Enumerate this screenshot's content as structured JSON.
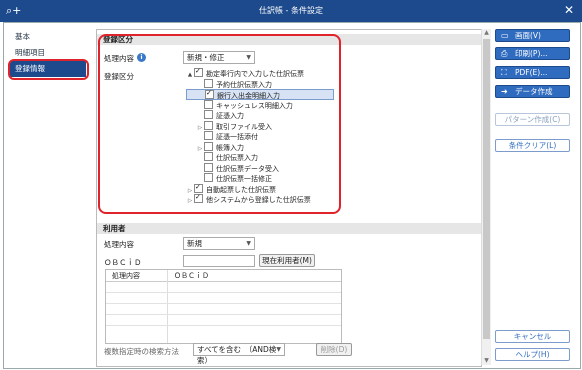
{
  "window": {
    "title": "仕訳帳 - 条件設定",
    "close_icon": "close-icon"
  },
  "sidebar": {
    "items": [
      {
        "label": "基本"
      },
      {
        "label": "明細項目"
      },
      {
        "label": "登録情報",
        "active": true
      }
    ]
  },
  "registration": {
    "section_title": "登録区分",
    "process_label": "処理内容",
    "process_value": "新規・修正",
    "category_label": "登録区分",
    "tree": [
      {
        "label": "勘定奉行内で入力した仕訳伝票",
        "checked": true,
        "expander": "▲",
        "indent": 0
      },
      {
        "label": "予約仕訳伝票入力",
        "checked": false,
        "indent": 1
      },
      {
        "label": "銀行入出金明細入力",
        "checked": true,
        "indent": 1,
        "selected": true
      },
      {
        "label": "キャッシュレス明細入力",
        "checked": false,
        "indent": 1
      },
      {
        "label": "証憑入力",
        "checked": false,
        "indent": 1
      },
      {
        "label": "取引ファイル受入",
        "checked": false,
        "expander": "▷",
        "indent": 1
      },
      {
        "label": "証憑一括添付",
        "checked": false,
        "indent": 1
      },
      {
        "label": "帳簿入力",
        "checked": false,
        "expander": "▷",
        "indent": 1
      },
      {
        "label": "仕訳伝票入力",
        "checked": false,
        "indent": 1
      },
      {
        "label": "仕訳伝票データ受入",
        "checked": false,
        "indent": 1
      },
      {
        "label": "仕訳伝票一括修正",
        "checked": false,
        "indent": 1
      },
      {
        "label": "自動起票した仕訳伝票",
        "checked": true,
        "expander": "▷",
        "indent": 0
      },
      {
        "label": "他システムから登録した仕訳伝票",
        "checked": true,
        "expander": "▷",
        "indent": 0
      }
    ]
  },
  "user": {
    "section_title": "利用者",
    "process_label": "処理内容",
    "process_value": "新規",
    "obcid_label": "ＯＢＣｉＤ",
    "current_user_button": "現在利用者(M)",
    "grid_headers": [
      "処理内容",
      "ＯＢＣｉＤ"
    ],
    "search_label": "複数指定時の検索方法",
    "search_value": "すべてを含む　（AND検索）",
    "delete_button": "削除(D)"
  },
  "right_buttons": [
    {
      "label": "画面(V)",
      "icon": "screen-icon",
      "glyph": "▭"
    },
    {
      "label": "印刷(P)...",
      "icon": "printer-icon",
      "glyph": "⎙"
    },
    {
      "label": "PDF(E)...",
      "icon": "pdf-icon",
      "glyph": "⛶"
    },
    {
      "label": "データ作成(E)...",
      "icon": "export-icon",
      "glyph": "➜"
    }
  ],
  "pattern_button": "パターン作成(C)",
  "clear_button": "条件クリア(L)",
  "cancel_button": "キャンセル",
  "help_button": "ヘルプ(H)",
  "colors": {
    "titlebar": "#1c4a8c",
    "accent": "#2f6bbf",
    "highlight": "#e0232b"
  }
}
